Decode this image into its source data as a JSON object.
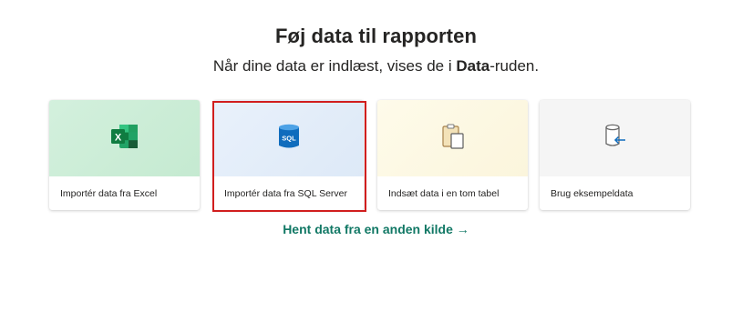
{
  "header": {
    "title": "Føj data til rapporten",
    "subtitle_before": "Når dine data er indlæst, vises de i ",
    "subtitle_bold": "Data",
    "subtitle_after": "-ruden."
  },
  "cards": [
    {
      "label": "Importér data fra Excel",
      "icon": "excel-icon"
    },
    {
      "label": "Importér data fra SQL Server",
      "icon": "sql-server-icon",
      "icon_text": "SQL",
      "selected": true
    },
    {
      "label": "Indsæt data i en tom tabel",
      "icon": "clipboard-icon"
    },
    {
      "label": "Brug eksempeldata",
      "icon": "sample-data-icon"
    }
  ],
  "other_source_link": "Hent data fra en anden kilde →",
  "colors": {
    "link": "#117865",
    "selection_border": "#d11e1e",
    "excel_green": "#1f7a45",
    "sql_blue": "#0f6cbd"
  }
}
